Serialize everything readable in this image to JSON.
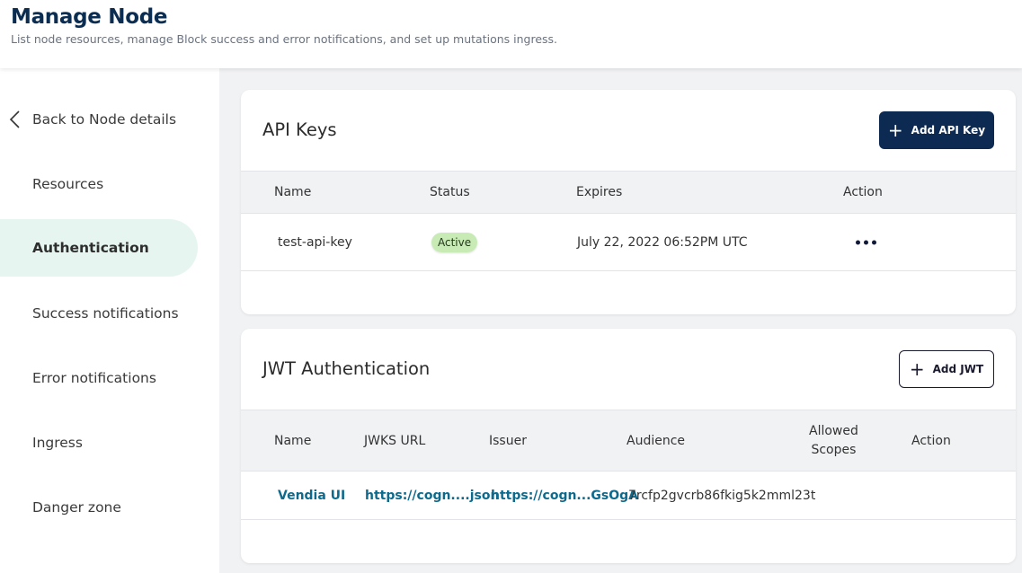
{
  "header": {
    "title": "Manage Node",
    "subtitle": "List node resources, manage Block success and error notifications, and set up mutations ingress."
  },
  "sidebar": {
    "back_label": "Back to Node details",
    "items": [
      {
        "label": "Resources",
        "active": false
      },
      {
        "label": "Authentication",
        "active": true
      },
      {
        "label": "Success notifications",
        "active": false
      },
      {
        "label": "Error notifications",
        "active": false
      },
      {
        "label": "Ingress",
        "active": false
      },
      {
        "label": "Danger zone",
        "active": false
      }
    ]
  },
  "api_keys": {
    "title": "API Keys",
    "add_button": "Add API Key",
    "columns": [
      "Name",
      "Status",
      "Expires",
      "Action"
    ],
    "rows": [
      {
        "name": "test-api-key",
        "status": "Active",
        "expires": "July 22, 2022 06:52PM UTC",
        "action_icon": "ellipsis-icon"
      }
    ]
  },
  "jwt": {
    "title": "JWT Authentication",
    "add_button": "Add JWT",
    "columns": [
      "Name",
      "JWKS URL",
      "Issuer",
      "Audience",
      "Allowed Scopes",
      "Action"
    ],
    "columns_wrapped": {
      "allowed_scopes_line1": "Allowed",
      "allowed_scopes_line2": "Scopes"
    },
    "rows": [
      {
        "name": "Vendia UI",
        "jwks_url": "https://cogn....json",
        "issuer": "https://cogn...GsOgA",
        "audience": "7rcfp2gvcrb86fkig5k2mml23t",
        "allowed_scopes": "",
        "action": ""
      }
    ]
  },
  "colors": {
    "brand_navy": "#0d2b52",
    "title_navy": "#0b2d52",
    "link_teal": "#0e6a8c",
    "active_nav_bg": "#e6f5ef",
    "badge_green": "#c8ebb6",
    "page_bg": "#f1f2f4"
  }
}
